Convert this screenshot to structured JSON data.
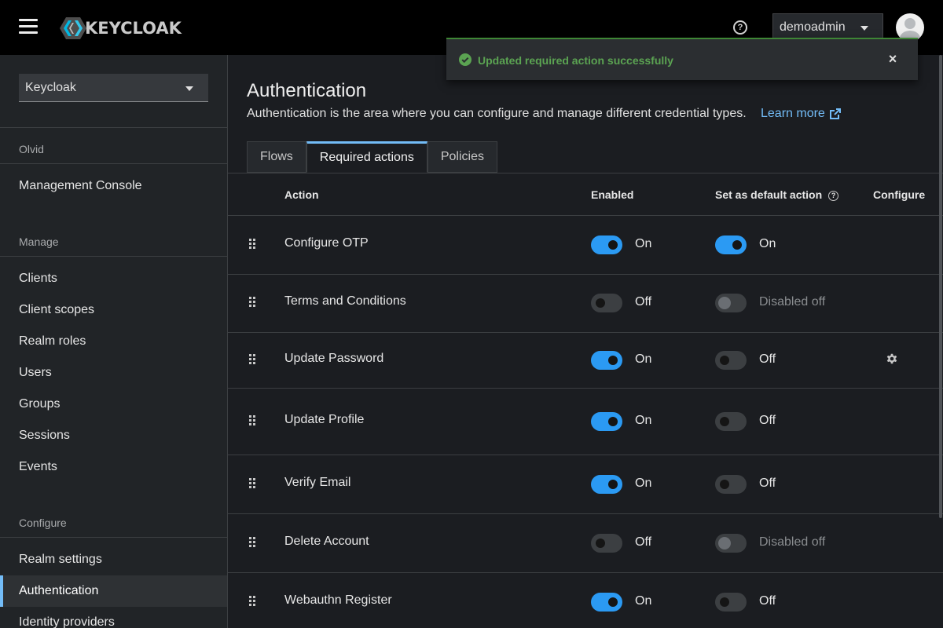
{
  "header": {
    "logo_text": "KEYCLOAK",
    "help_icon": "?",
    "user": "demoadmin"
  },
  "sidebar": {
    "realm": "Keycloak",
    "sections": {
      "olvid": "Olvid",
      "manage": "Manage",
      "configure": "Configure"
    },
    "items": {
      "management_console": "Management Console",
      "clients": "Clients",
      "client_scopes": "Client scopes",
      "realm_roles": "Realm roles",
      "users": "Users",
      "groups": "Groups",
      "sessions": "Sessions",
      "events": "Events",
      "realm_settings": "Realm settings",
      "authentication": "Authentication",
      "identity_providers": "Identity providers"
    }
  },
  "page": {
    "title": "Authentication",
    "description": "Authentication is the area where you can configure and manage different credential types.",
    "learn_more": "Learn more"
  },
  "tabs": [
    "Flows",
    "Required actions",
    "Policies"
  ],
  "table": {
    "headers": {
      "action": "Action",
      "enabled": "Enabled",
      "default": "Set as default action",
      "configure": "Configure"
    },
    "rows": [
      {
        "name": "Configure OTP",
        "enabled": "On",
        "enabled_state": "on",
        "default": "On",
        "default_state": "on",
        "configurable": false
      },
      {
        "name": "Terms and Conditions",
        "enabled": "Off",
        "enabled_state": "off",
        "default": "Disabled off",
        "default_state": "disabled",
        "configurable": false
      },
      {
        "name": "Update Password",
        "enabled": "On",
        "enabled_state": "on",
        "default": "Off",
        "default_state": "off",
        "configurable": true
      },
      {
        "name": "Update Profile",
        "enabled": "On",
        "enabled_state": "on",
        "default": "Off",
        "default_state": "off",
        "configurable": false
      },
      {
        "name": "Verify Email",
        "enabled": "On",
        "enabled_state": "on",
        "default": "Off",
        "default_state": "off",
        "configurable": false
      },
      {
        "name": "Delete Account",
        "enabled": "Off",
        "enabled_state": "off",
        "default": "Disabled off",
        "default_state": "disabled",
        "configurable": false
      },
      {
        "name": "Webauthn Register",
        "enabled": "On",
        "enabled_state": "on",
        "default": "Off",
        "default_state": "off",
        "configurable": false
      }
    ]
  },
  "toast": {
    "message": "Updated required action successfully",
    "close": "×"
  },
  "colors": {
    "accent": "#73bcf7",
    "switch_on": "#2b9af3",
    "success": "#3e8635"
  },
  "icons": {
    "menu": "hamburger-icon",
    "help": "help-icon",
    "external": "external-link-icon",
    "drag": "drag-handle-icon",
    "gear": "gear-icon",
    "success": "check-circle-icon",
    "close": "close-icon"
  }
}
